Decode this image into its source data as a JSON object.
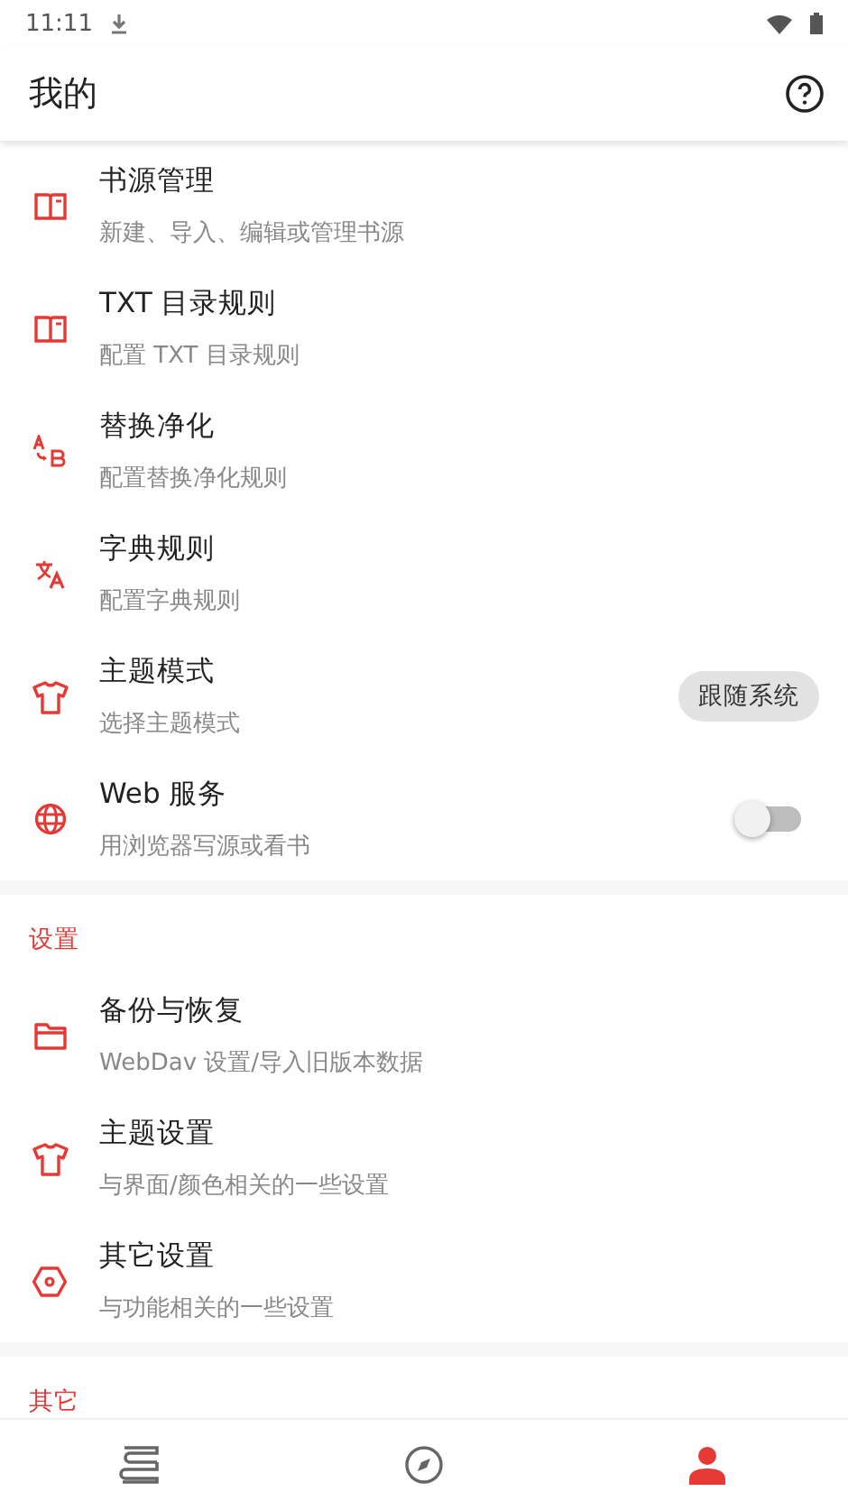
{
  "status_bar": {
    "time": "11:11"
  },
  "app_bar": {
    "title": "我的"
  },
  "sections": [
    {
      "items": [
        {
          "title": "书源管理",
          "subtitle": "新建、导入、编辑或管理书源"
        },
        {
          "title": "TXT 目录规则",
          "subtitle": "配置 TXT 目录规则"
        },
        {
          "title": "替换净化",
          "subtitle": "配置替换净化规则"
        },
        {
          "title": "字典规则",
          "subtitle": "配置字典规则"
        },
        {
          "title": "主题模式",
          "subtitle": "选择主题模式",
          "trailing": {
            "kind": "chip",
            "label": "跟随系统"
          }
        },
        {
          "title": "Web 服务",
          "subtitle": "用浏览器写源或看书",
          "trailing": {
            "kind": "switch",
            "on": false
          }
        }
      ]
    },
    {
      "header": "设置",
      "items": [
        {
          "title": "备份与恢复",
          "subtitle": "WebDav 设置/导入旧版本数据"
        },
        {
          "title": "主题设置",
          "subtitle": "与界面/颜色相关的一些设置"
        },
        {
          "title": "其它设置",
          "subtitle": "与功能相关的一些设置"
        }
      ]
    },
    {
      "header": "其它"
    }
  ],
  "bottom_nav": [
    {
      "selected": false
    },
    {
      "selected": false
    },
    {
      "selected": true
    }
  ]
}
